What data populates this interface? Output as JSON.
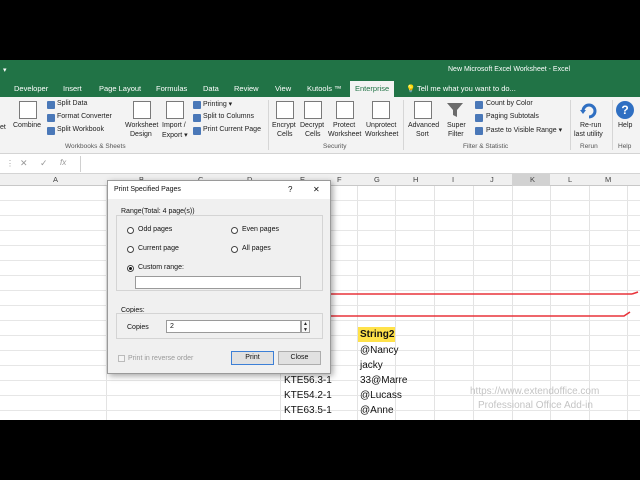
{
  "window": {
    "title": "New Microsoft Excel Worksheet - Excel"
  },
  "tabs": [
    {
      "label": "Developer",
      "active": false
    },
    {
      "label": "Insert",
      "active": false
    },
    {
      "label": "Page Layout",
      "active": false
    },
    {
      "label": "Formulas",
      "active": false
    },
    {
      "label": "Data",
      "active": false
    },
    {
      "label": "Review",
      "active": false
    },
    {
      "label": "View",
      "active": false
    },
    {
      "label": "Kutools ™",
      "active": false
    },
    {
      "label": "Enterprise",
      "active": true
    }
  ],
  "tell_me": "Tell me what you want to do...",
  "ribbon": {
    "combine": "Combine",
    "split_data": "Split Data",
    "format_converter": "Format Converter",
    "split_workbook": "Split Workbook",
    "worksheet_design_1": "Worksheet",
    "worksheet_design_2": "Design",
    "import_export_1": "Import /",
    "import_export_2": "Export ▾",
    "printing": "Printing ▾",
    "split_to_columns": "Split to Columns",
    "print_current_page": "Print Current Page",
    "group_workbooks": "Workbooks & Sheets",
    "encrypt_1": "Encrypt",
    "encrypt_2": "Cells",
    "decrypt_1": "Decrypt",
    "decrypt_2": "Cells",
    "protect_1": "Protect",
    "protect_2": "Worksheet",
    "unprotect_1": "Unprotect",
    "unprotect_2": "Worksheet",
    "group_security": "Security",
    "adv_sort_1": "Advanced",
    "adv_sort_2": "Sort",
    "super_filter_1": "Super",
    "super_filter_2": "Filter",
    "count_by_color": "Count by Color",
    "paging_subtotals": "Paging Subtotals",
    "paste_visible": "Paste to Visible Range ▾",
    "group_filter": "Filter & Statistic",
    "rerun_1": "Re-run",
    "rerun_2": "last utility",
    "group_rerun": "Rerun",
    "help": "Help",
    "group_help": "Help"
  },
  "columns": [
    "A",
    "B",
    "C",
    "D",
    "E",
    "F",
    "G",
    "H",
    "I",
    "J",
    "K",
    "L",
    "M"
  ],
  "cells": {
    "header": "String2",
    "g1": "@Nancy",
    "g2": "jacky",
    "e3": "KTE56.3-1",
    "g3": "33@Marre",
    "e4": "KTE54.2-1",
    "g4": "@Lucass",
    "e5": "KTE63.5-1",
    "g5": "@Anne"
  },
  "watermark": {
    "url": "https://www.extendoffice.com",
    "tagline": "Professional Office Add-in"
  },
  "dialog": {
    "title": "Print Specified Pages",
    "help": "?",
    "close": "✕",
    "range_label": "Range(Total: 4 page(s))",
    "odd": "Odd pages",
    "even": "Even pages",
    "current": "Current page",
    "all": "All pages",
    "custom": "Custom range:",
    "custom_value": "",
    "copies_group": "Copies:",
    "copies_label": "Copies",
    "copies_value": "2",
    "reverse": "Print in reverse order",
    "print_btn": "Print",
    "close_btn": "Close"
  },
  "colors": {
    "excel_green": "#217346",
    "annotation_red": "#e8333a",
    "highlight": "#ffe24a"
  }
}
